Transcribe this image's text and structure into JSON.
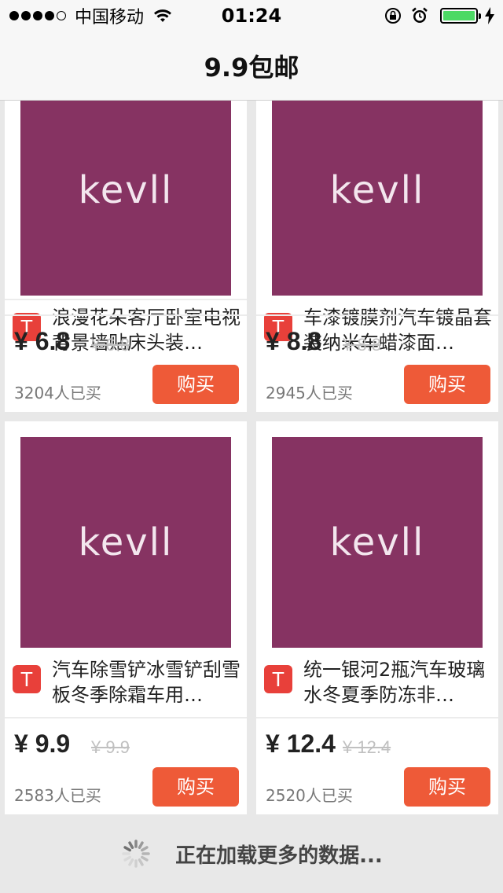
{
  "status_bar": {
    "carrier": "中国移动",
    "time": "01:24",
    "battery_level": 1.0
  },
  "nav": {
    "title": "9.9包邮"
  },
  "products": [
    {
      "logo": "kevll",
      "badge": "T",
      "title": "浪漫花朵客厅卧室电视背景墙贴床头装…",
      "price": "¥ 6.8",
      "old_price": "¥ 6.8",
      "sold": "3204人已买",
      "buy": "购买"
    },
    {
      "logo": "kevll",
      "badge": "T",
      "title": "车漆镀膜剂汽车镀晶套装纳米车蜡漆面…",
      "price": "¥ 8.8",
      "old_price": "¥ 8.8",
      "sold": "2945人已买",
      "buy": "购买"
    },
    {
      "logo": "kevll",
      "badge": "T",
      "title": "汽车除雪铲冰雪铲刮雪板冬季除霜车用…",
      "price": "¥ 9.9",
      "old_price": "¥ 9.9",
      "sold": "2583人已买",
      "buy": "购买"
    },
    {
      "logo": "kevll",
      "badge": "T",
      "title": "统一银河2瓶汽车玻璃水冬夏季防冻非…",
      "price": "¥ 12.4",
      "old_price": "¥ 12.4",
      "sold": "2520人已买",
      "buy": "购买"
    }
  ],
  "loading": {
    "text": "正在加载更多的数据..."
  },
  "colors": {
    "accent": "#ee5a38",
    "badge": "#e8403a",
    "image_bg": "#863362"
  }
}
